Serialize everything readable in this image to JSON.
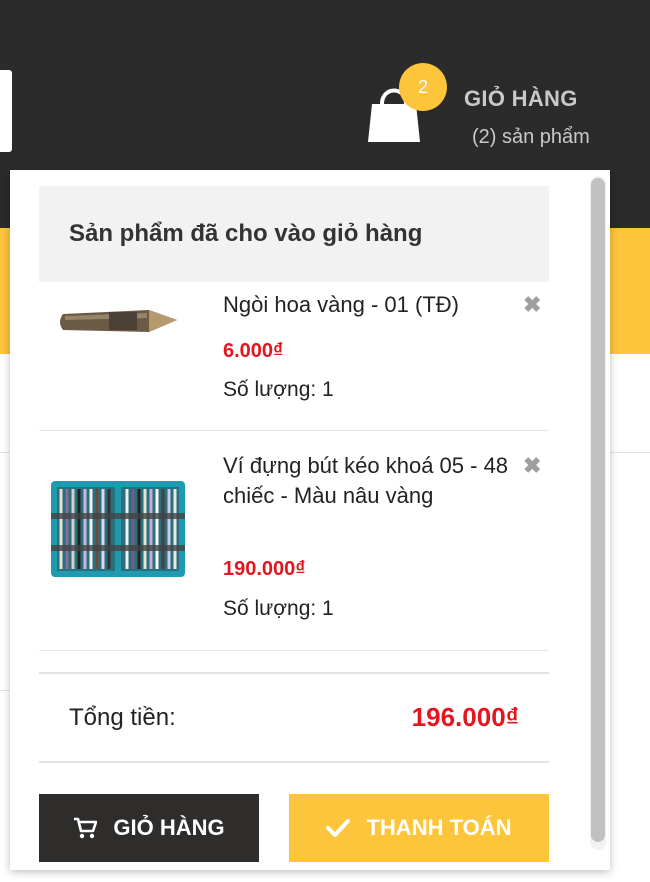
{
  "header": {
    "cart_title": "GIỎ HÀNG",
    "cart_count_text": "(2) sản phẩm",
    "badge_count": "2"
  },
  "dropdown": {
    "title": "Sản phẩm đã cho vào giỏ hàng",
    "items": [
      {
        "name": "Ngòi hoa vàng - 01 (TĐ)",
        "price": "6.000₫",
        "qty": "Số lượng: 1",
        "remove": "✖"
      },
      {
        "name": "Ví đựng bút kéo khoá 05 - 48 chiếc - Màu nâu vàng",
        "price": "190.000₫",
        "qty": "Số lượng: 1",
        "remove": "✖"
      }
    ],
    "total_label": "Tổng tiền:",
    "total_value": "196.000₫",
    "cart_button": "GIỎ HÀNG",
    "checkout_button": "THANH TOÁN"
  },
  "colors": {
    "accent": "#fdc53c",
    "dark": "#2b2b2b",
    "price": "#e4151f"
  }
}
